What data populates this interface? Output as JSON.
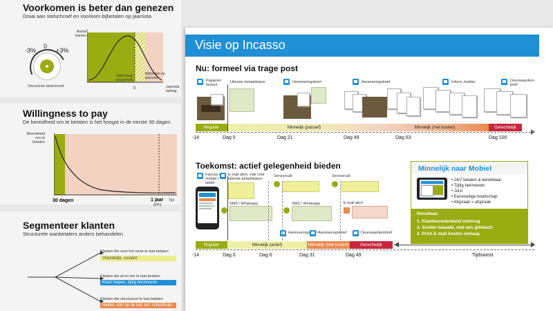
{
  "panel1": {
    "title": "Voorkomen is beter dan genezen",
    "subtitle": "Draai aan stelschroef en voorkom bijbetalen op jaarnota",
    "dial_zero": "0",
    "dial_minus": "-3%",
    "dial_plus": "+3%",
    "dial_caption": "Voorschot stelschroef",
    "y_label": "Aantal klanten",
    "x_zero": "0",
    "x_label": "Jaarnota bedrag",
    "left_region": "Geld terug op jaarnota",
    "right_region": "Bijbetalen op jaarnota"
  },
  "panel2": {
    "title": "Willingness to pay",
    "subtitle": "De bereidheid om te betalen is het hoogst in de eerste 30 dagen",
    "y_label": "Bereidheid om te betalen",
    "x_left": "30 dagen",
    "x_right": "1 jaar",
    "x_right_sub": "(KPI)",
    "x_axis": "Tijd"
  },
  "panel3": {
    "title": "Segmenteer klanten",
    "subtitle": "Structurele wanbetalers anders behandelen",
    "branches": [
      {
        "text": "Klanten die voor het eerst te laat betalen",
        "tag": "Vriendelijk, coulant",
        "color": "#ecec8a",
        "text_color": "#444"
      },
      {
        "text": "Klanten die af en toe te laat betalen",
        "tag": "Klant helpen, tijdig herinneren",
        "color": "#1f8fd6",
        "text_color": "#ffffff"
      },
      {
        "text": "Klanten die structureel te laat betalen",
        "tag": "Helder, kort op de bal, evt. schuldhulp",
        "color": "#e98a4e",
        "text_color": "#ffffff"
      }
    ]
  },
  "main": {
    "title": "Visie op Incasso",
    "now_heading": "Nu: formeel via trage post",
    "future_heading": "Toekomst: actief gelegenheid bieden",
    "now_events": [
      "Papieren factuur",
      "Uiterste betaaldatum",
      "Herinneringsbrief",
      "Aanmaningsbrief",
      "Inform Justitia",
      "Deurwaarders-brief"
    ],
    "now_segments": [
      "Regulier",
      "Minnelijk (passief)",
      "Minnelijk (met kosten)",
      "Gerechtelijk"
    ],
    "now_ticks": [
      "-14",
      "Dag 0",
      "Dag 21",
      "Dag 49",
      "Dag 63",
      "Dag 100"
    ],
    "future_events": [
      "Factuur op mobiel / tablet",
      "E-mail alert, vlak voor uiterste betaaldatum",
      "Servicecall",
      "Servicecall",
      "SMS / Whatsapp",
      "SMS / Whatsapp",
      "E-mail alert",
      "Herinneringsbrief",
      "Aanmaningsbrief",
      "Deurwaardersbrief"
    ],
    "future_segments": [
      "Regulier",
      "Minnelijk (actief)",
      "Minnelijk (met kosten)",
      "Gerechtelijk"
    ],
    "future_ticks": [
      "-14",
      "Dag 0",
      "Dag 6",
      "Dag 31",
      "Dag 49"
    ],
    "tijdswinst": "Tijdswinst",
    "mobile_box": {
      "title": "Minnelijk naar Mobiel",
      "bullets": [
        "24/7 betalen & bereikbaar",
        "Tijdig herinneren",
        "Juist",
        "Eenvoudige boodschap",
        "Afspraak = afspraak"
      ],
      "result_title": "Resultaat:",
      "results": [
        "1. Klanttevredenheid omhoog",
        "2. Sneller betaald, met een glimlach",
        "3. Print & mail kosten omlaag"
      ]
    }
  },
  "colors": {
    "blue": "#1f8fd6",
    "olive": "#9bab12",
    "yellow": "#eef0a6",
    "orange": "#e98a4e",
    "red": "#c9253c",
    "salmon": "#f3d2c2"
  }
}
